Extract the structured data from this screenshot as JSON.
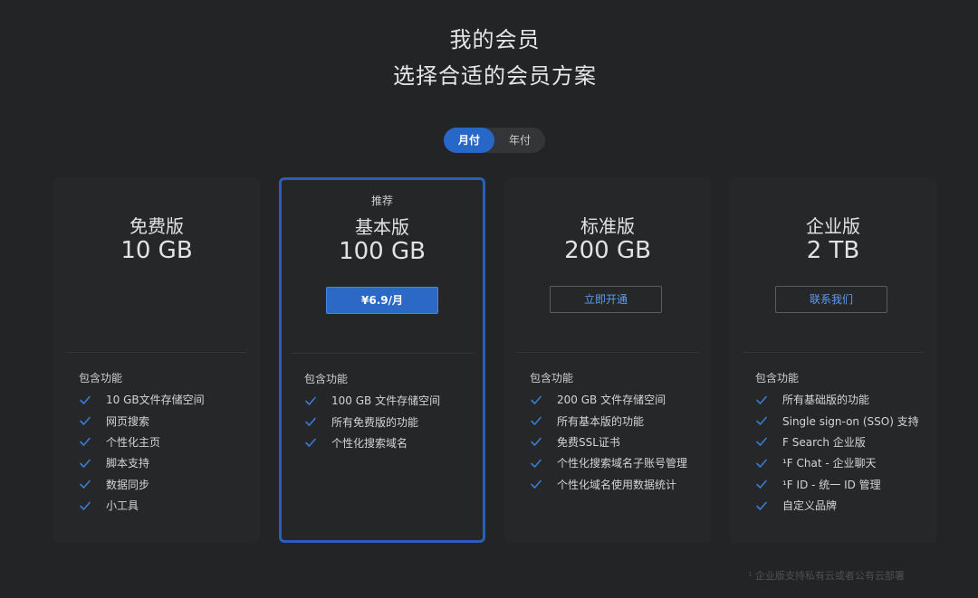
{
  "header": {
    "title": "我的会员",
    "subtitle": "选择合适的会员方案"
  },
  "billing_toggle": {
    "options": [
      {
        "label": "月付",
        "active": true
      },
      {
        "label": "年付",
        "active": false
      }
    ]
  },
  "plans": [
    {
      "name": "免费版",
      "size": "10 GB",
      "features_title": "包含功能",
      "features": [
        "10 GB文件存储空间",
        "网页搜索",
        "个性化主页",
        "脚本支持",
        "数据同步",
        "小工具"
      ]
    },
    {
      "tag": "推荐",
      "name": "基本版",
      "size": "100 GB",
      "cta": "¥6.9/月",
      "features_title": "包含功能",
      "features": [
        "100 GB 文件存储空间",
        "所有免费版的功能",
        "个性化搜索域名"
      ]
    },
    {
      "name": "标准版",
      "size": "200 GB",
      "cta": "立即开通",
      "features_title": "包含功能",
      "features": [
        "200 GB 文件存储空间",
        "所有基本版的功能",
        "免费SSL证书",
        "个性化搜索域名子账号管理",
        "个性化域名使用数据统计"
      ]
    },
    {
      "name": "企业版",
      "size": "2 TB",
      "cta": "联系我们",
      "features_title": "包含功能",
      "features": [
        "所有基础版的功能",
        "Single sign-on (SSO) 支持",
        "F Search 企业版",
        "¹F Chat - 企业聊天",
        "¹F ID - 统一 ID 管理",
        "自定义品牌"
      ]
    }
  ],
  "footnote": "¹ 企业版支持私有云或者公有云部署",
  "colors": {
    "background": "#232425",
    "accent": "#2767c7",
    "check": "#3a7bd5"
  }
}
